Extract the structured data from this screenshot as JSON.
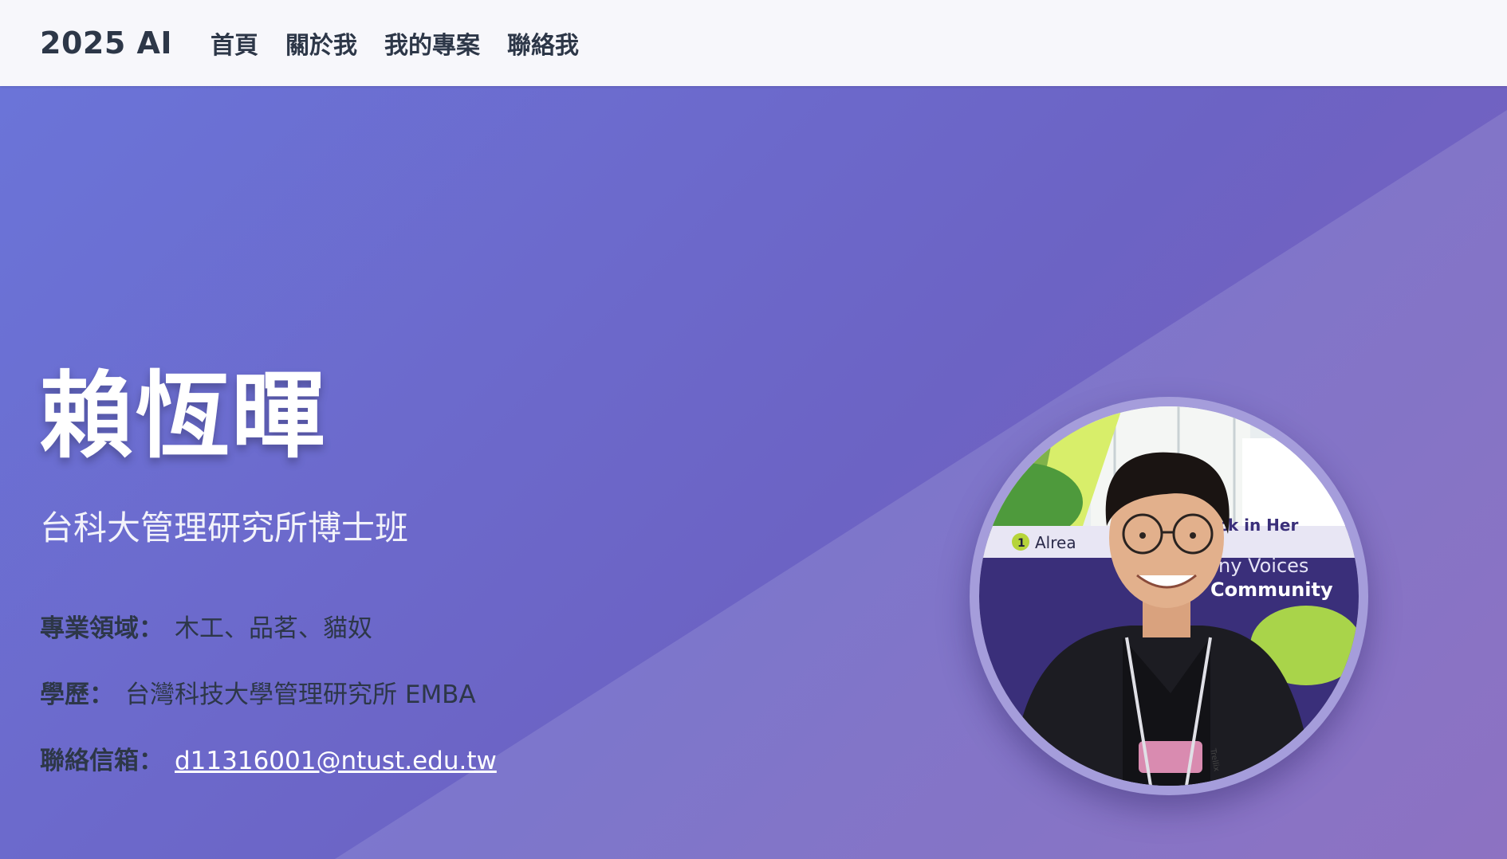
{
  "nav": {
    "brand": "2025 AI",
    "links": [
      "首頁",
      "關於我",
      "我的專案",
      "聯絡我"
    ]
  },
  "hero": {
    "name": "賴恆暉",
    "subtitle": "台科大管理研究所博士班",
    "info": [
      {
        "label": "專業領域：",
        "value": "木工、品茗、貓奴"
      },
      {
        "label": "學歷：",
        "value": "台灣科技大學管理研究所 EMBA"
      },
      {
        "label": "聯絡信箱：",
        "value": "d11316001@ntust.edu.tw"
      }
    ]
  },
  "photo": {
    "banner_texts": [
      "1",
      "Alrea",
      "ck in Her",
      "ny Voices",
      "Community",
      "Trellix"
    ]
  },
  "colors": {
    "nav_bg": "#f7f7fb",
    "hero_start": "#6b74d8",
    "hero_end": "#7e5fba",
    "text_dark": "#2d3748",
    "avatar_ring": "#a59ddb"
  }
}
